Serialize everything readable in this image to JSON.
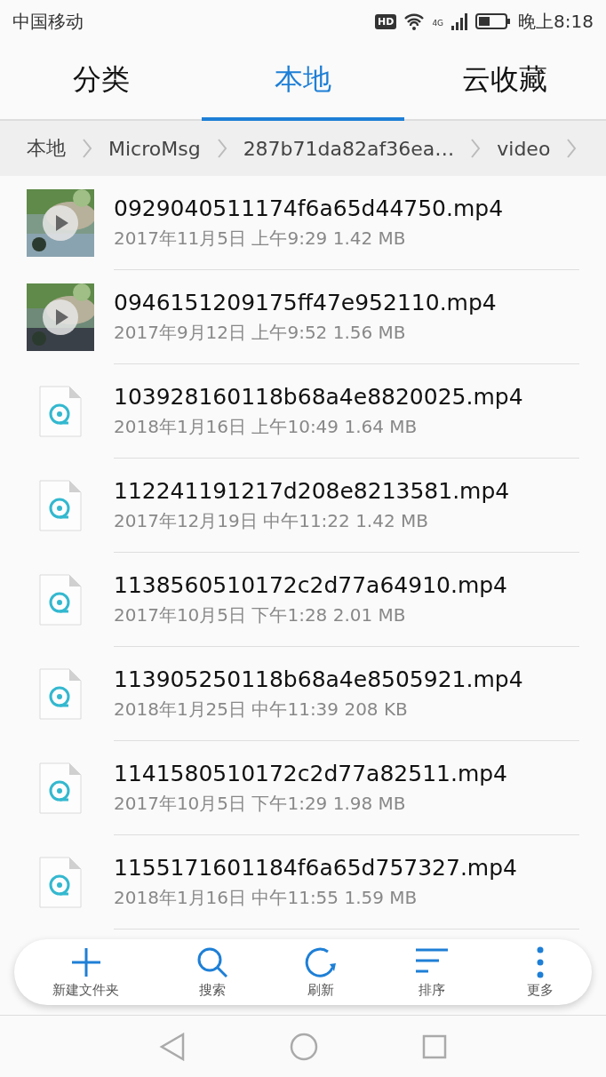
{
  "status_bar": {
    "carrier": "中国移动",
    "time": "晚上8:18",
    "network": "4G",
    "hd": "HD"
  },
  "tabs": [
    {
      "label": "分类",
      "selected": false
    },
    {
      "label": "本地",
      "selected": true
    },
    {
      "label": "云收藏",
      "selected": false
    }
  ],
  "breadcrumbs": [
    "本地",
    "MicroMsg",
    "287b71da82af36ea…",
    "video"
  ],
  "files": [
    {
      "kind": "thumbnail",
      "name": "0929040511174f6a65d44750.mp4",
      "meta": "2017年11月5日 上午9:29 1.42 MB"
    },
    {
      "kind": "thumbnail",
      "name": "0946151209175ff47e952110.mp4",
      "meta": "2017年9月12日 上午9:52 1.56 MB"
    },
    {
      "kind": "video",
      "name": "103928160118b68a4e8820025.mp4",
      "meta": "2018年1月16日 上午10:49 1.64 MB"
    },
    {
      "kind": "video",
      "name": "112241191217d208e8213581.mp4",
      "meta": "2017年12月19日 中午11:22 1.42 MB"
    },
    {
      "kind": "video",
      "name": "1138560510172c2d77a64910.mp4",
      "meta": "2017年10月5日 下午1:28 2.01 MB"
    },
    {
      "kind": "video",
      "name": "113905250118b68a4e8505921.mp4",
      "meta": "2018年1月25日 中午11:39 208 KB"
    },
    {
      "kind": "video",
      "name": "1141580510172c2d77a82511.mp4",
      "meta": "2017年10月5日 下午1:29 1.98 MB"
    },
    {
      "kind": "video",
      "name": "1155171601184f6a65d757327.mp4",
      "meta": "2018年1月16日 中午11:55 1.59 MB"
    }
  ],
  "toolbar": [
    {
      "kind": "add",
      "label": "新建文件夹"
    },
    {
      "kind": "search",
      "label": "搜索"
    },
    {
      "kind": "refresh",
      "label": "刷新"
    },
    {
      "kind": "sort",
      "label": "排序"
    },
    {
      "kind": "more",
      "label": "更多"
    }
  ]
}
